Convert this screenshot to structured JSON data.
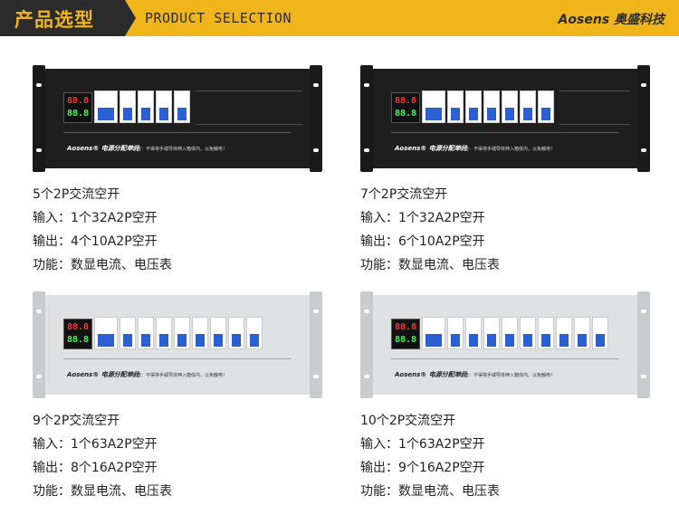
{
  "header": {
    "title": "产品选型",
    "subtitle": "PRODUCT SELECTION",
    "brand": "Aosens 奥盛科技"
  },
  "products": [
    {
      "title": "5个2P交流空开",
      "input": "输入：1个32A2P空开",
      "output": "输出：4个10A2P空开",
      "function": "功能：数显电流、电压表",
      "panel_label": "Aosens® 电源分配单元",
      "panel_warning": "警告：不得将手或导体伸入箱体内，以免触电！",
      "panel_color": "black",
      "breaker_count": 5
    },
    {
      "title": "7个2P交流空开",
      "input": "输入：1个32A2P空开",
      "output": "输出：6个10A2P空开",
      "function": "功能：数显电流、电压表",
      "panel_label": "Aosens® 电源分配单元",
      "panel_warning": "警告：不得将手或导体伸入箱体内，以免触电！",
      "panel_color": "black",
      "breaker_count": 7
    },
    {
      "title": "9个2P交流空开",
      "input": "输入：1个63A2P空开",
      "output": "输出：8个16A2P空开",
      "function": "功能：数显电流、电压表",
      "panel_label": "Aosens® 电源分配单元",
      "panel_warning": "警告：不得将手或导体伸入箱体内，以免触电！",
      "panel_color": "silver",
      "breaker_count": 9
    },
    {
      "title": "10个2P交流空开",
      "input": "输入：1个63A2P空开",
      "output": "输出：9个16A2P空开",
      "function": "功能：数显电流、电压表",
      "panel_label": "Aosens® 电源分配单元",
      "panel_warning": "警告：不得将手或导体伸入箱体内，以免触电！",
      "panel_color": "silver",
      "breaker_count": 10
    }
  ]
}
